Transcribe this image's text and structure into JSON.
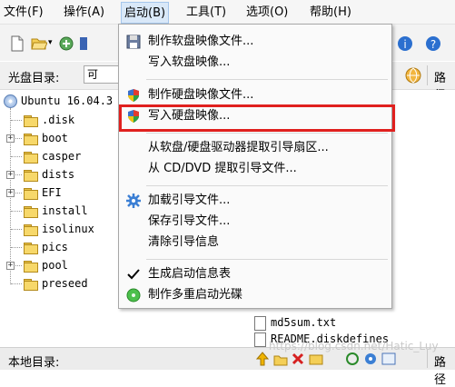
{
  "menubar": {
    "items": [
      {
        "label": "文件(F)"
      },
      {
        "label": "操作(A)"
      },
      {
        "label": "启动(B)"
      },
      {
        "label": "工具(T)"
      },
      {
        "label": "选项(O)"
      },
      {
        "label": "帮助(H)"
      }
    ]
  },
  "addressbar": {
    "label": "光盘目录:",
    "value": "可",
    "right_label": "路径"
  },
  "tree": {
    "root": "Ubuntu 16.04.3",
    "folders": [
      ".disk",
      "boot",
      "casper",
      "dists",
      "EFI",
      "install",
      "isolinux",
      "pics",
      "pool",
      "preseed"
    ]
  },
  "files": [
    {
      "name": "md5sum.txt"
    },
    {
      "name": "README.diskdefines"
    }
  ],
  "statusbar": {
    "label": "本地目录:",
    "right_label": "路径"
  },
  "watermark": "https://blog.csdn.net/Hatic_Luy",
  "dropdown": {
    "items": [
      {
        "label": "制作软盘映像文件...",
        "icon": "floppy-icon"
      },
      {
        "label": "写入软盘映像...",
        "icon": ""
      },
      {
        "label": "制作硬盘映像文件...",
        "icon": "shield-icon"
      },
      {
        "label": "写入硬盘映像...",
        "icon": "shield-icon"
      },
      {
        "label": "从软盘/硬盘驱动器提取引导扇区...",
        "icon": ""
      },
      {
        "label": "从 CD/DVD 提取引导文件...",
        "icon": ""
      },
      {
        "label": "加载引导文件...",
        "icon": "gear-icon"
      },
      {
        "label": "保存引导文件...",
        "icon": ""
      },
      {
        "label": "清除引导信息",
        "icon": ""
      },
      {
        "label": "生成启动信息表",
        "icon": "check-icon"
      },
      {
        "label": "制作多重启动光碟",
        "icon": "disc-green-icon"
      }
    ]
  },
  "colors": {
    "highlight_border": "#e0201e",
    "active_menu_bg": "#d9e8f8"
  }
}
